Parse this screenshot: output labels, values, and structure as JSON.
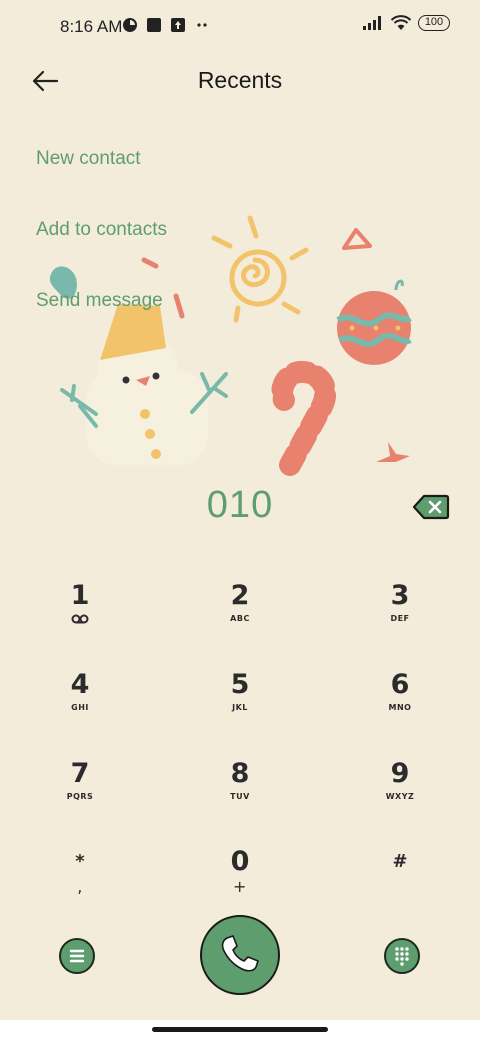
{
  "status_bar": {
    "time": "8:16 AM",
    "battery": "100",
    "icons": [
      "app-icon",
      "square-icon",
      "upload-icon",
      "more-dots-icon",
      "signal-icon",
      "wifi-icon"
    ]
  },
  "header": {
    "title": "Recents",
    "back_icon": "back-arrow-icon"
  },
  "actions": {
    "new_contact": "New contact",
    "add_to_contacts": "Add to contacts",
    "send_message": "Send message"
  },
  "dialer": {
    "number": "010",
    "backspace_icon": "backspace-icon"
  },
  "keys": [
    {
      "digit": "1",
      "letters": ""
    },
    {
      "digit": "2",
      "letters": "ABC"
    },
    {
      "digit": "3",
      "letters": "DEF"
    },
    {
      "digit": "4",
      "letters": "GHI"
    },
    {
      "digit": "5",
      "letters": "JKL"
    },
    {
      "digit": "6",
      "letters": "MNO"
    },
    {
      "digit": "7",
      "letters": "PQRS"
    },
    {
      "digit": "8",
      "letters": "TUV"
    },
    {
      "digit": "9",
      "letters": "WXYZ"
    },
    {
      "digit": "*",
      "letters": ","
    },
    {
      "digit": "0",
      "letters": "+"
    },
    {
      "digit": "#",
      "letters": ""
    }
  ],
  "bottom": {
    "menu_icon": "menu-icon",
    "call_icon": "phone-icon",
    "dialpad_icon": "dialpad-icon"
  },
  "colors": {
    "background": "#f4ecda",
    "accent": "#5e9e6e"
  }
}
